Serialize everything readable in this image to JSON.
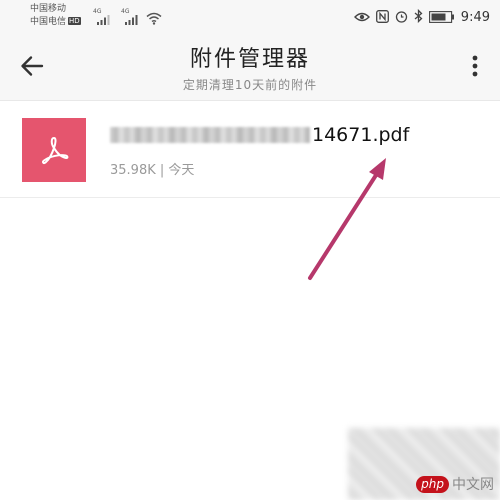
{
  "status_bar": {
    "carrier_1": "中国移动",
    "carrier_2": "中国电信",
    "carrier_2_badge": "HD",
    "network_1": "4G",
    "network_2": "4G",
    "battery_level": 0.8,
    "time": "9:49",
    "icons": [
      "eye-icon",
      "nfc-icon",
      "alarm-icon",
      "bluetooth-icon",
      "battery-icon",
      "wifi-icon",
      "signal-icon"
    ]
  },
  "header": {
    "title": "附件管理器",
    "subtitle": "定期清理10天前的附件"
  },
  "files": [
    {
      "name_visible": "14671.pdf",
      "size": "35.98K",
      "separator": "|",
      "date": "今天",
      "icon": "pdf-icon"
    }
  ],
  "watermark": {
    "logo_text": "php",
    "site_text": "中文网"
  },
  "colors": {
    "pdf_tile": "#e5556e",
    "arrow": "#b6386b",
    "watermark_logo": "#c4121b"
  }
}
